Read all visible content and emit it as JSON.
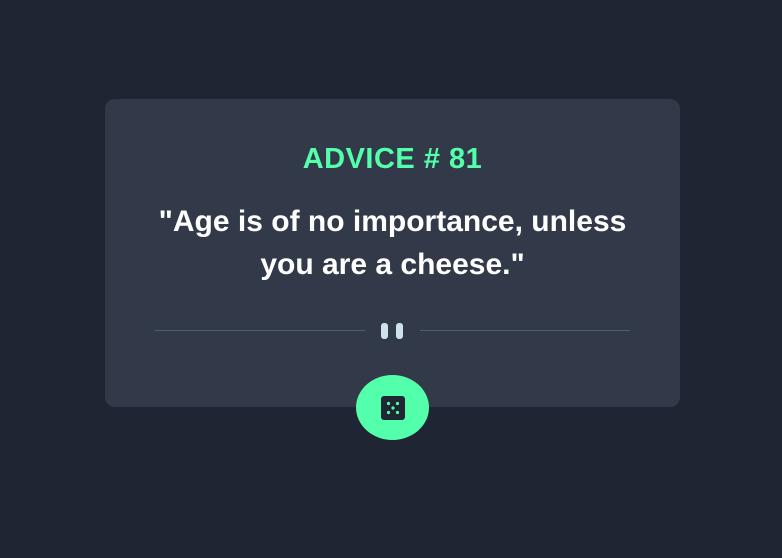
{
  "colors": {
    "page_background": "#1f2532",
    "card_background": "#323a49",
    "accent_green": "#53ffab",
    "quote_text": "#ffffff",
    "divider_line": "#4f5d74",
    "pause_icon": "#cee3e9",
    "dice_icon_bg": "#202733"
  },
  "advice": {
    "title": "ADVICE # 81",
    "quote": "\"Age is of no importance, unless you are a cheese.\""
  },
  "icons": {
    "divider_icon": "pause-icon",
    "button_icon": "dice-icon"
  }
}
